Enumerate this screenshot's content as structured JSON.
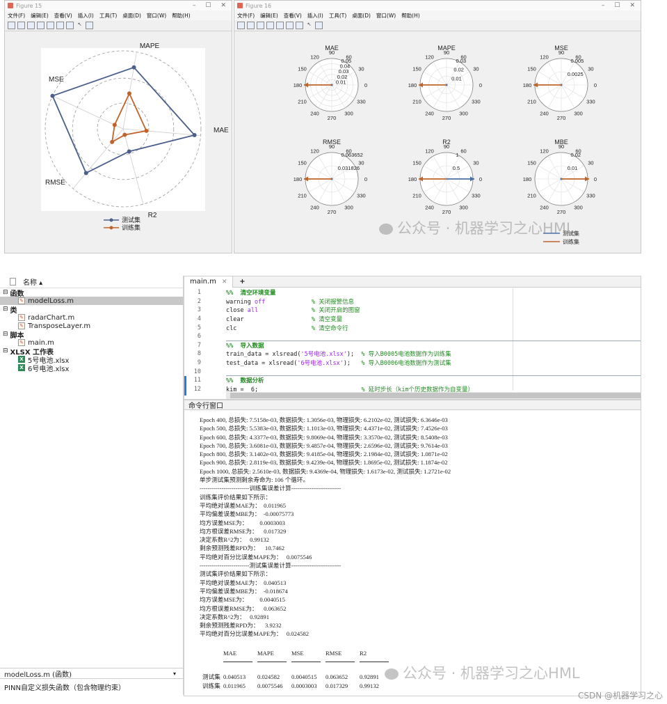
{
  "fig15": {
    "title": "Figure 15",
    "menus": [
      "文件(F)",
      "编辑(E)",
      "查看(V)",
      "插入(I)",
      "工具(T)",
      "桌面(D)",
      "窗口(W)",
      "帮助(H)"
    ],
    "radar": {
      "axes": [
        "MAE",
        "MAPE",
        "MSE",
        "RMSE",
        "R2"
      ],
      "legend": [
        "测试集",
        "训练集"
      ],
      "colors": {
        "test": "#4a5f8a",
        "train": "#c0632a"
      }
    }
  },
  "fig16": {
    "title": "Figure 16",
    "menus": [
      "文件(F)",
      "编辑(E)",
      "查看(V)",
      "插入(I)",
      "工具(T)",
      "桌面(D)",
      "窗口(W)",
      "帮助(H)"
    ],
    "polars": [
      {
        "title": "MAE",
        "rings": [
          "0.01",
          "0.02",
          "0.03",
          "0.04",
          "0.05"
        ],
        "dir": "left"
      },
      {
        "title": "MAPE",
        "rings": [
          "0.01",
          "0.02",
          "0.03"
        ],
        "dir": "left"
      },
      {
        "title": "MSE",
        "rings": [
          "0.0025",
          "0.005"
        ],
        "dir": "left"
      },
      {
        "title": "RMSE",
        "rings": [
          "0.031826",
          "0.063652"
        ],
        "dir": "left"
      },
      {
        "title": "R2",
        "rings": [
          "0.5",
          "1"
        ],
        "dir": "both"
      },
      {
        "title": "MBE",
        "rings": [
          "0.01",
          "0.02"
        ],
        "dir": "right"
      }
    ],
    "angles": [
      "90",
      "60",
      "30",
      "0",
      "330",
      "300",
      "270",
      "240",
      "210",
      "180",
      "150",
      "120"
    ],
    "legend": [
      "测试集",
      "训练集"
    ]
  },
  "watermark": "公众号 · 机器学习之心HML",
  "browser": {
    "header": "名称 ▴",
    "sections": [
      {
        "label": "函数",
        "items": [
          {
            "name": "modelLoss.m",
            "type": "m",
            "selected": true
          }
        ]
      },
      {
        "label": "类",
        "items": [
          {
            "name": "radarChart.m",
            "type": "m"
          },
          {
            "name": "TransposeLayer.m",
            "type": "m"
          }
        ]
      },
      {
        "label": "脚本",
        "items": [
          {
            "name": "main.m",
            "type": "m"
          }
        ]
      },
      {
        "label": "XLSX 工作表",
        "items": [
          {
            "name": "5号电池.xlsx",
            "type": "x"
          },
          {
            "name": "6号电池.xlsx",
            "type": "x"
          }
        ]
      }
    ],
    "detail_title": "modelLoss.m (函数)",
    "detail_desc": "PINN自定义损失函数（包含物理约束）"
  },
  "editor": {
    "tab": "main.m",
    "lines": [
      {
        "n": "1",
        "parts": [
          [
            "c",
            "%%  清空环境变量"
          ]
        ]
      },
      {
        "n": "2",
        "parts": [
          [
            "",
            "warning "
          ],
          [
            "s",
            "off"
          ],
          [
            "",
            "             "
          ],
          [
            "cm",
            "% 关闭报警信息"
          ]
        ]
      },
      {
        "n": "3",
        "parts": [
          [
            "",
            "close "
          ],
          [
            "s",
            "all"
          ],
          [
            "",
            "               "
          ],
          [
            "cm",
            "% 关闭开启的图窗"
          ]
        ]
      },
      {
        "n": "4",
        "parts": [
          [
            "",
            "clear                   "
          ],
          [
            "cm",
            "% 清空变量"
          ]
        ]
      },
      {
        "n": "5",
        "parts": [
          [
            "",
            "clc                     "
          ],
          [
            "cm",
            "% 清空命令行"
          ]
        ]
      },
      {
        "n": "6",
        "parts": []
      },
      {
        "n": "7",
        "parts": [
          [
            "c",
            "%%  导入数据"
          ]
        ]
      },
      {
        "n": "8",
        "parts": [
          [
            "",
            "train_data = xlsread("
          ],
          [
            "str",
            "'5号电池.xlsx'"
          ],
          [
            "",
            ");  "
          ],
          [
            "cm",
            "% 导入B0005电池数据作为训练集"
          ]
        ]
      },
      {
        "n": "9",
        "parts": [
          [
            "",
            "test_data = xlsread("
          ],
          [
            "str",
            "'6号电池.xlsx'"
          ],
          [
            "",
            ");   "
          ],
          [
            "cm",
            "% 导入B0006电池数据作为测试集"
          ]
        ]
      },
      {
        "n": "10",
        "parts": []
      },
      {
        "n": "11",
        "parts": [
          [
            "c",
            "%%  数据分析"
          ]
        ]
      },
      {
        "n": "12",
        "parts": [
          [
            "",
            "kim =  6;                             "
          ],
          [
            "cm",
            "% 延时步长（kim个历史数据作为自变量）"
          ]
        ]
      }
    ]
  },
  "cmd": {
    "title": "命令行窗口",
    "lines": [
      "Epoch 400, 总损失: 7.5158e-03, 数据损失: 1.3056e-03, 物理损失: 6.2102e-02, 测试损失: 6.3646e-03",
      "Epoch 500, 总损失: 5.5383e-03, 数据损失: 1.1013e-03, 物理损失: 4.4371e-02, 测试损失: 7.4526e-03",
      "Epoch 600, 总损失: 4.3377e-03, 数据损失: 9.8069e-04, 物理损失: 3.3570e-02, 测试损失: 8.5408e-03",
      "Epoch 700, 总损失: 3.6081e-03, 数据损失: 9.4857e-04, 物理损失: 2.6596e-02, 测试损失: 9.7614e-03",
      "Epoch 800, 总损失: 3.1402e-03, 数据损失: 9.4185e-04, 物理损失: 2.1984e-02, 测试损失: 1.0871e-02",
      "Epoch 900, 总损失: 2.8119e-03, 数据损失: 9.4239e-04, 物理损失: 1.8695e-02, 测试损失: 1.1874e-02",
      "Epoch 1000, 总损失: 2.5610e-03, 数据损失: 9.4369e-04, 物理损失: 1.6173e-02, 测试损失: 1.2721e-02",
      "单步测试集预测剩余寿命为: 106 个循环。",
      "-------------------------训练集误差计算-------------------------",
      "训练集评价结果如下所示：",
      "平均绝对误差MAE为：  0.011965",
      "平均偏差误差MBE为：  -0.00075773",
      "均方误差MSE为：        0.0003003",
      "均方根误差RMSE为：    0.017329",
      "决定系数R^2为：   0.99132",
      "剩余预测残差RPD为：    10.7462",
      "平均绝对百分比误差MAPE为：   0.0075546",
      "-------------------------测试集误差计算-------------------------",
      "测试集评价结果如下所示：",
      "平均绝对误差MAE为：  0.040513",
      "平均偏差误差MBE为：  -0.018674",
      "均方误差MSE为：        0.0040515",
      "均方根误差RMSE为：    0.063652",
      "决定系数R^2为：   0.92891",
      "剩余预测残差RPD为：    3.9232",
      "平均绝对百分比误差MAPE为：   0.024582"
    ],
    "table": {
      "headers": [
        "MAE",
        "MAPE",
        "MSE",
        "RMSE",
        "R2"
      ],
      "rows": [
        {
          "label": "测试集",
          "values": [
            "0.040513",
            "0.024582",
            "0.0040515",
            "0.063652",
            "0.92891"
          ]
        },
        {
          "label": "训练集",
          "values": [
            "0.011965",
            "0.0075546",
            "0.0003003",
            "0.017329",
            "0.99132"
          ]
        }
      ]
    }
  },
  "csdn": "CSDN @机器学习之心"
}
